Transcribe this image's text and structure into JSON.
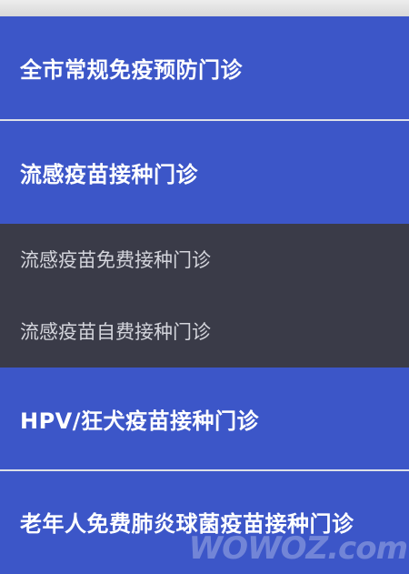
{
  "colors": {
    "menu_background": "#3c56c8",
    "submenu_background": "#3a3b48",
    "divider": "#dcdfe8",
    "main_text": "#ffffff",
    "sub_text": "#d4d5dc"
  },
  "menu": {
    "items": [
      {
        "label": "全市常规免疫预防门诊"
      },
      {
        "label": "流感疫苗接种门诊",
        "submenu": [
          {
            "label": "流感疫苗免费接种门诊"
          },
          {
            "label": "流感疫苗自费接种门诊"
          }
        ]
      },
      {
        "label": "HPV/狂犬疫苗接种门诊"
      },
      {
        "label": "老年人免费肺炎球菌疫苗接种门诊"
      }
    ]
  },
  "watermark": {
    "text": "WOWOZ.com"
  }
}
